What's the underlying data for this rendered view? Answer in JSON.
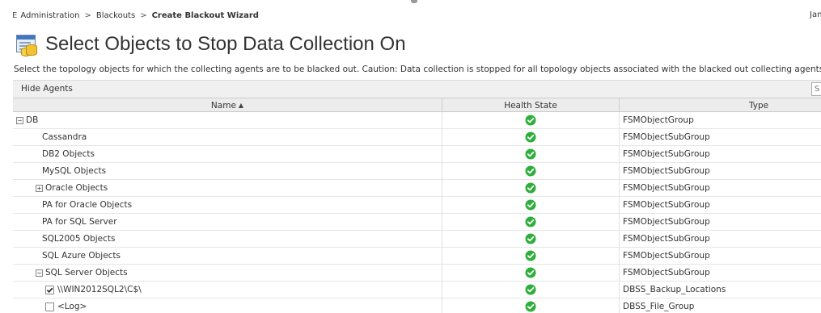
{
  "breadcrumb": {
    "home_glyph": "E",
    "items": [
      "Administration",
      "Blackouts"
    ],
    "current": "Create Blackout Wizard",
    "separator": ">"
  },
  "user_label": "Jan",
  "page": {
    "title": "Select Objects to Stop Data Collection On",
    "description": "Select the topology objects for which the collecting agents are to be blacked out. Caution: Data collection is stopped for all topology objects associated with the blacked out collecting agents; that is, not just the"
  },
  "toolbar": {
    "hide_agents_label": "Hide Agents",
    "search_placeholder": "S"
  },
  "grid": {
    "columns": {
      "name": "Name",
      "health": "Health State",
      "type": "Type"
    },
    "sort_indicator": "▲",
    "rows": [
      {
        "name": "DB",
        "type": "FSMObjectGroup",
        "indent": 0,
        "control": "collapse",
        "health": "ok"
      },
      {
        "name": "Cassandra",
        "type": "FSMObjectSubGroup",
        "indent": 1,
        "control": "none",
        "health": "ok"
      },
      {
        "name": "DB2 Objects",
        "type": "FSMObjectSubGroup",
        "indent": 1,
        "control": "none",
        "health": "ok"
      },
      {
        "name": "MySQL Objects",
        "type": "FSMObjectSubGroup",
        "indent": 1,
        "control": "none",
        "health": "ok"
      },
      {
        "name": "Oracle Objects",
        "type": "FSMObjectSubGroup",
        "indent": 1,
        "control": "expand",
        "health": "ok"
      },
      {
        "name": "PA for Oracle Objects",
        "type": "FSMObjectSubGroup",
        "indent": 1,
        "control": "none",
        "health": "ok"
      },
      {
        "name": "PA for SQL Server",
        "type": "FSMObjectSubGroup",
        "indent": 1,
        "control": "none",
        "health": "ok"
      },
      {
        "name": "SQL2005 Objects",
        "type": "FSMObjectSubGroup",
        "indent": 1,
        "control": "none",
        "health": "ok"
      },
      {
        "name": "SQL Azure Objects",
        "type": "FSMObjectSubGroup",
        "indent": 1,
        "control": "none",
        "health": "ok"
      },
      {
        "name": "SQL Server Objects",
        "type": "FSMObjectSubGroup",
        "indent": 1,
        "control": "collapse",
        "health": "ok"
      },
      {
        "name": "\\\\WIN2012SQL2\\C$\\",
        "type": "DBSS_Backup_Locations",
        "indent": 2,
        "control": "checkbox",
        "checked": true,
        "health": "ok"
      },
      {
        "name": "<Log>",
        "type": "DBSS_File_Group",
        "indent": 2,
        "control": "checkbox",
        "checked": false,
        "health": "ok"
      }
    ]
  },
  "colors": {
    "health_ok": "#2fae3b",
    "header_bg": "#ececec",
    "toolbar_bg": "#f0f0f0"
  },
  "icons": {
    "health_ok": "check-circle-icon",
    "title": "blackout-wizard-icon",
    "expand": "plus-box-icon",
    "collapse": "minus-box-icon"
  }
}
